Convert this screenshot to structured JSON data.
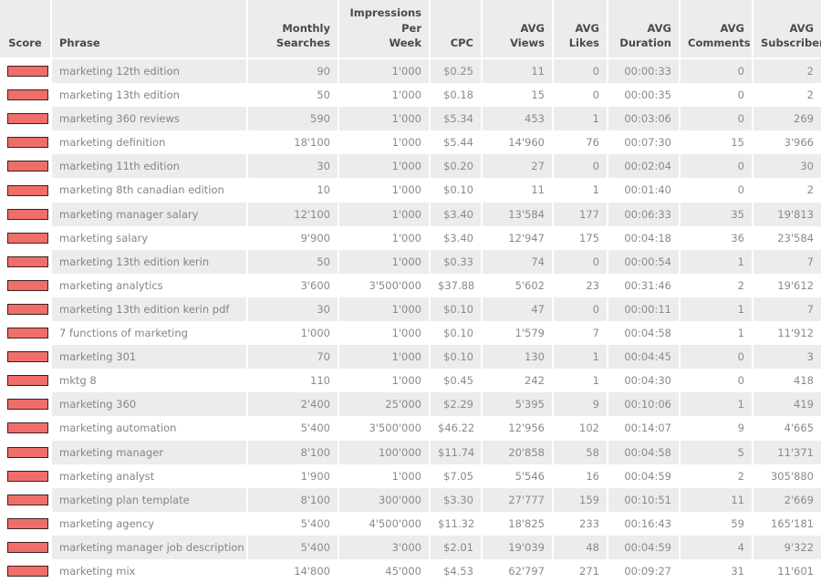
{
  "table": {
    "columns": [
      {
        "key": "score",
        "label": "Score",
        "align": "center"
      },
      {
        "key": "phrase",
        "label": "Phrase",
        "align": "left"
      },
      {
        "key": "monthly",
        "label": "Monthly Searches",
        "align": "right"
      },
      {
        "key": "impressions",
        "label": "Impressions Per Week",
        "align": "right"
      },
      {
        "key": "cpc",
        "label": "CPC",
        "align": "right"
      },
      {
        "key": "views",
        "label": "AVG Views",
        "align": "right"
      },
      {
        "key": "likes",
        "label": "AVG Likes",
        "align": "right"
      },
      {
        "key": "duration",
        "label": "AVG Duration",
        "align": "right"
      },
      {
        "key": "comments",
        "label": "AVG Comments",
        "align": "right"
      },
      {
        "key": "subscribers",
        "label": "AVG Subscribers",
        "align": "right"
      }
    ],
    "header_labels": {
      "score": "Score",
      "phrase": "Phrase",
      "monthly_line1": "Monthly",
      "monthly_line2": "Searches",
      "impressions_line1": "Impressions Per",
      "impressions_line2": "Week",
      "cpc": "CPC",
      "views": "AVG Views",
      "likes_line1": "AVG",
      "likes_line2": "Likes",
      "duration_line1": "AVG",
      "duration_line2": "Duration",
      "comments_line1": "AVG",
      "comments_line2": "Comments",
      "subscribers_line1": "AVG",
      "subscribers_line2": "Subscribers"
    },
    "score_indicator": {
      "icon": "score-bar-indicator",
      "fill_color": "#ef6e6a",
      "border_color": "#3b2222"
    },
    "colors": {
      "header_background": "#ececec",
      "header_text": "#4a4a4a",
      "row_odd_background": "#ececec",
      "row_even_background": "#ffffff",
      "cell_text": "#8a8a8a",
      "phrase_text": "#848484",
      "cell_divider": "#ffffff"
    },
    "rows": [
      {
        "phrase": "marketing 12th edition",
        "monthly": "90",
        "impressions": "1'000",
        "cpc": "$0.25",
        "views": "11",
        "likes": "0",
        "duration": "00:00:33",
        "comments": "0",
        "subscribers": "2"
      },
      {
        "phrase": "marketing 13th edition",
        "monthly": "50",
        "impressions": "1'000",
        "cpc": "$0.18",
        "views": "15",
        "likes": "0",
        "duration": "00:00:35",
        "comments": "0",
        "subscribers": "2"
      },
      {
        "phrase": "marketing 360 reviews",
        "monthly": "590",
        "impressions": "1'000",
        "cpc": "$5.34",
        "views": "453",
        "likes": "1",
        "duration": "00:03:06",
        "comments": "0",
        "subscribers": "269"
      },
      {
        "phrase": "marketing definition",
        "monthly": "18'100",
        "impressions": "1'000",
        "cpc": "$5.44",
        "views": "14'960",
        "likes": "76",
        "duration": "00:07:30",
        "comments": "15",
        "subscribers": "3'966"
      },
      {
        "phrase": "marketing 11th edition",
        "monthly": "30",
        "impressions": "1'000",
        "cpc": "$0.20",
        "views": "27",
        "likes": "0",
        "duration": "00:02:04",
        "comments": "0",
        "subscribers": "30"
      },
      {
        "phrase": "marketing 8th canadian edition",
        "monthly": "10",
        "impressions": "1'000",
        "cpc": "$0.10",
        "views": "11",
        "likes": "1",
        "duration": "00:01:40",
        "comments": "0",
        "subscribers": "2"
      },
      {
        "phrase": "marketing manager salary",
        "monthly": "12'100",
        "impressions": "1'000",
        "cpc": "$3.40",
        "views": "13'584",
        "likes": "177",
        "duration": "00:06:33",
        "comments": "35",
        "subscribers": "19'813"
      },
      {
        "phrase": "marketing salary",
        "monthly": "9'900",
        "impressions": "1'000",
        "cpc": "$3.40",
        "views": "12'947",
        "likes": "175",
        "duration": "00:04:18",
        "comments": "36",
        "subscribers": "23'584"
      },
      {
        "phrase": "marketing 13th edition kerin",
        "monthly": "50",
        "impressions": "1'000",
        "cpc": "$0.33",
        "views": "74",
        "likes": "0",
        "duration": "00:00:54",
        "comments": "1",
        "subscribers": "7"
      },
      {
        "phrase": "marketing analytics",
        "monthly": "3'600",
        "impressions": "3'500'000",
        "cpc": "$37.88",
        "views": "5'602",
        "likes": "23",
        "duration": "00:31:46",
        "comments": "2",
        "subscribers": "19'612"
      },
      {
        "phrase": "marketing 13th edition kerin pdf",
        "monthly": "30",
        "impressions": "1'000",
        "cpc": "$0.10",
        "views": "47",
        "likes": "0",
        "duration": "00:00:11",
        "comments": "1",
        "subscribers": "7"
      },
      {
        "phrase": "7 functions of marketing",
        "monthly": "1'000",
        "impressions": "1'000",
        "cpc": "$0.10",
        "views": "1'579",
        "likes": "7",
        "duration": "00:04:58",
        "comments": "1",
        "subscribers": "11'912"
      },
      {
        "phrase": "marketing 301",
        "monthly": "70",
        "impressions": "1'000",
        "cpc": "$0.10",
        "views": "130",
        "likes": "1",
        "duration": "00:04:45",
        "comments": "0",
        "subscribers": "3"
      },
      {
        "phrase": "mktg 8",
        "monthly": "110",
        "impressions": "1'000",
        "cpc": "$0.45",
        "views": "242",
        "likes": "1",
        "duration": "00:04:30",
        "comments": "0",
        "subscribers": "418"
      },
      {
        "phrase": "marketing 360",
        "monthly": "2'400",
        "impressions": "25'000",
        "cpc": "$2.29",
        "views": "5'395",
        "likes": "9",
        "duration": "00:10:06",
        "comments": "1",
        "subscribers": "419"
      },
      {
        "phrase": "marketing automation",
        "monthly": "5'400",
        "impressions": "3'500'000",
        "cpc": "$46.22",
        "views": "12'956",
        "likes": "102",
        "duration": "00:14:07",
        "comments": "9",
        "subscribers": "4'665"
      },
      {
        "phrase": "marketing manager",
        "monthly": "8'100",
        "impressions": "100'000",
        "cpc": "$11.74",
        "views": "20'858",
        "likes": "58",
        "duration": "00:04:58",
        "comments": "5",
        "subscribers": "11'371"
      },
      {
        "phrase": "marketing analyst",
        "monthly": "1'900",
        "impressions": "1'000",
        "cpc": "$7.05",
        "views": "5'546",
        "likes": "16",
        "duration": "00:04:59",
        "comments": "2",
        "subscribers": "305'880"
      },
      {
        "phrase": "marketing plan template",
        "monthly": "8'100",
        "impressions": "300'000",
        "cpc": "$3.30",
        "views": "27'777",
        "likes": "159",
        "duration": "00:10:51",
        "comments": "11",
        "subscribers": "2'669"
      },
      {
        "phrase": "marketing agency",
        "monthly": "5'400",
        "impressions": "4'500'000",
        "cpc": "$11.32",
        "views": "18'825",
        "likes": "233",
        "duration": "00:16:43",
        "comments": "59",
        "subscribers": "165'181"
      },
      {
        "phrase": "marketing manager job description",
        "monthly": "5'400",
        "impressions": "3'000",
        "cpc": "$2.01",
        "views": "19'039",
        "likes": "48",
        "duration": "00:04:59",
        "comments": "4",
        "subscribers": "9'322"
      },
      {
        "phrase": "marketing mix",
        "monthly": "14'800",
        "impressions": "45'000",
        "cpc": "$4.53",
        "views": "62'797",
        "likes": "271",
        "duration": "00:09:27",
        "comments": "31",
        "subscribers": "11'601"
      }
    ]
  }
}
